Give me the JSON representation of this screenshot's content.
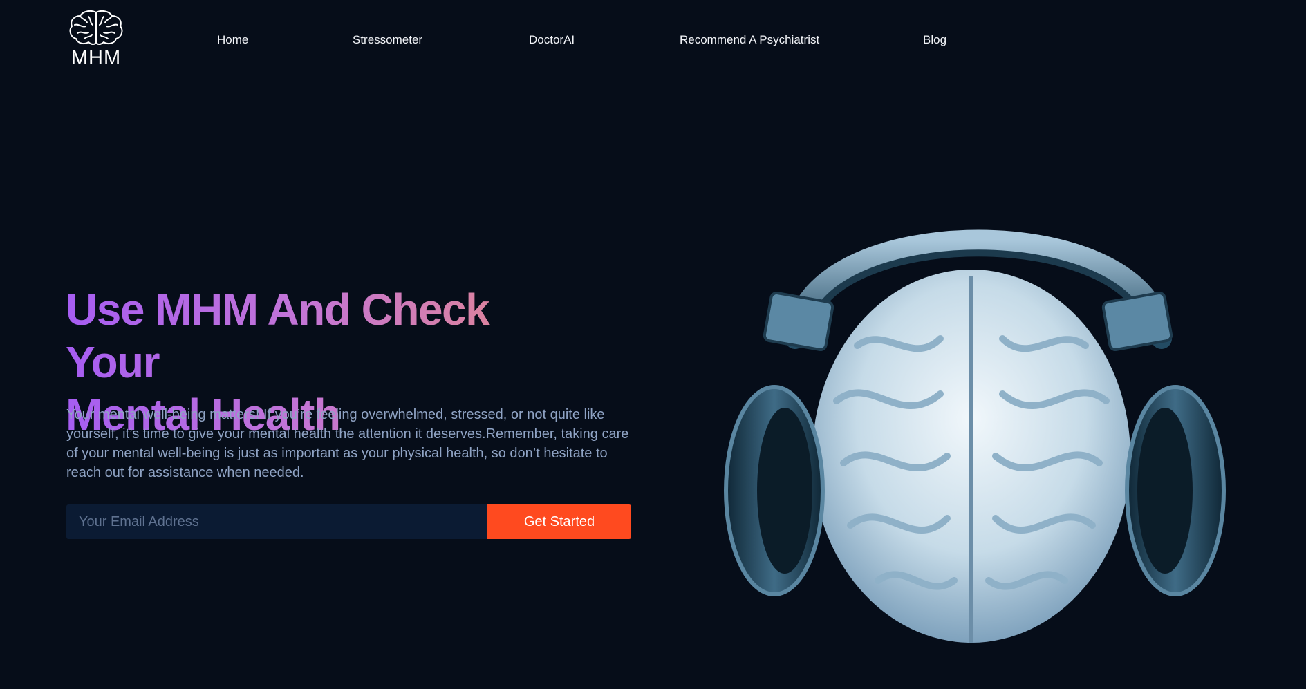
{
  "brand": {
    "logo_icon": "brain-icon",
    "name": "MHM"
  },
  "nav": {
    "items": [
      {
        "label": "Home"
      },
      {
        "label": "Stressometer"
      },
      {
        "label": "DoctorAI"
      },
      {
        "label": "Recommend A Psychiatrist"
      },
      {
        "label": "Blog"
      }
    ]
  },
  "hero": {
    "title_line1": "Use MHM And Check Your",
    "title_line2": "Mental Health",
    "description": "Your mental well-being matters! If you’re feeling overwhelmed, stressed, or not quite like yourself, it’s time to give your mental health the attention it deserves.Remember, taking care of your mental well-being is just as important as your physical health, so don’t hesitate to reach out for assistance when needed.",
    "email_placeholder": "Your Email Address",
    "cta_label": "Get Started",
    "image_icon": "brain-with-headphones-illustration"
  },
  "colors": {
    "background": "#060d19",
    "accent": "#ff4a1f",
    "gradient_start": "#a65df2",
    "gradient_end": "#e88a83",
    "body_text": "#8fa3c4",
    "input_bg": "#0b1b33"
  }
}
